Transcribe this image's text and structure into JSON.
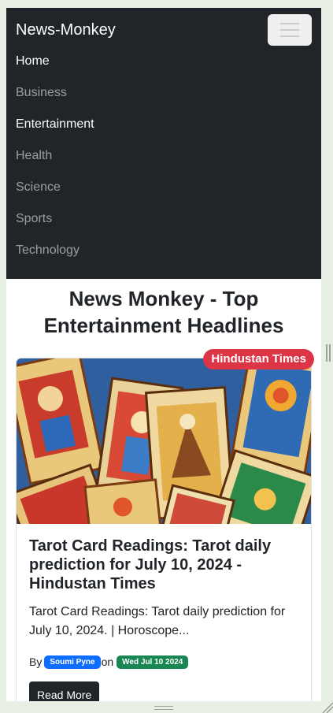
{
  "navbar": {
    "brand": "News-Monkey",
    "toggler_icon": "hamburger-icon",
    "background": "#212529",
    "items": [
      {
        "label": "Home",
        "active": true
      },
      {
        "label": "Business",
        "active": false
      },
      {
        "label": "Entertainment",
        "active": true
      },
      {
        "label": "Health",
        "active": false
      },
      {
        "label": "Science",
        "active": false
      },
      {
        "label": "Sports",
        "active": false
      },
      {
        "label": "Technology",
        "active": false
      }
    ]
  },
  "page": {
    "title_line1": "News Monkey - Top",
    "title_line2": "Entertainment Headlines"
  },
  "article": {
    "source": "Hindustan Times",
    "image_alt": "tarot-cards-image",
    "title": "Tarot Card Readings: Tarot daily prediction for July 10, 2024 - Hindustan Times",
    "description": "Tarot Card Readings: Tarot daily prediction for July 10, 2024. | Horoscope...",
    "by_label": "By",
    "author": "Soumi Pyne",
    "on_label": "on",
    "date": "Wed Jul 10 2024",
    "read_more": "Read More"
  },
  "colors": {
    "source_badge": "#dc3545",
    "author_badge": "#0d6efd",
    "date_badge": "#198754",
    "button": "#212529"
  }
}
